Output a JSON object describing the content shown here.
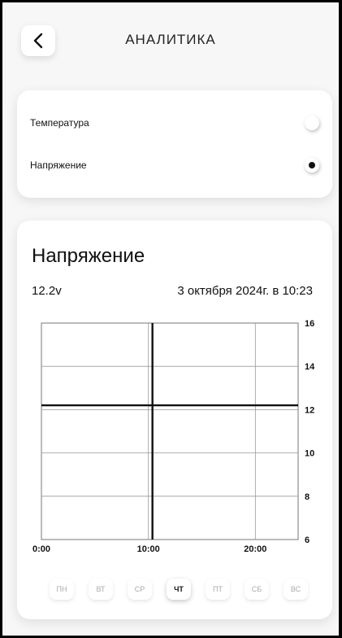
{
  "header": {
    "title": "АНАЛИТИКА",
    "back_icon": "chevron-left-icon"
  },
  "selector": {
    "items": [
      {
        "label": "Температура",
        "selected": false
      },
      {
        "label": "Напряжение",
        "selected": true
      }
    ]
  },
  "chart_section": {
    "title": "Напряжение",
    "current_value": "12.2v",
    "timestamp": "3 октября 2024г. в 10:23"
  },
  "chart_data": {
    "type": "line",
    "x_ticks": [
      "0:00",
      "10:00",
      "20:00"
    ],
    "xlim": [
      0,
      24
    ],
    "y_ticks": [
      "6",
      "8",
      "10",
      "12",
      "14",
      "16"
    ],
    "ylim": [
      6,
      16
    ],
    "grid": true,
    "crosshair": {
      "x": 10.38,
      "y": 12.2
    },
    "series": []
  },
  "days": {
    "items": [
      "ПН",
      "ВТ",
      "СР",
      "ЧТ",
      "ПТ",
      "СБ",
      "ВС"
    ],
    "active": "ЧТ"
  }
}
